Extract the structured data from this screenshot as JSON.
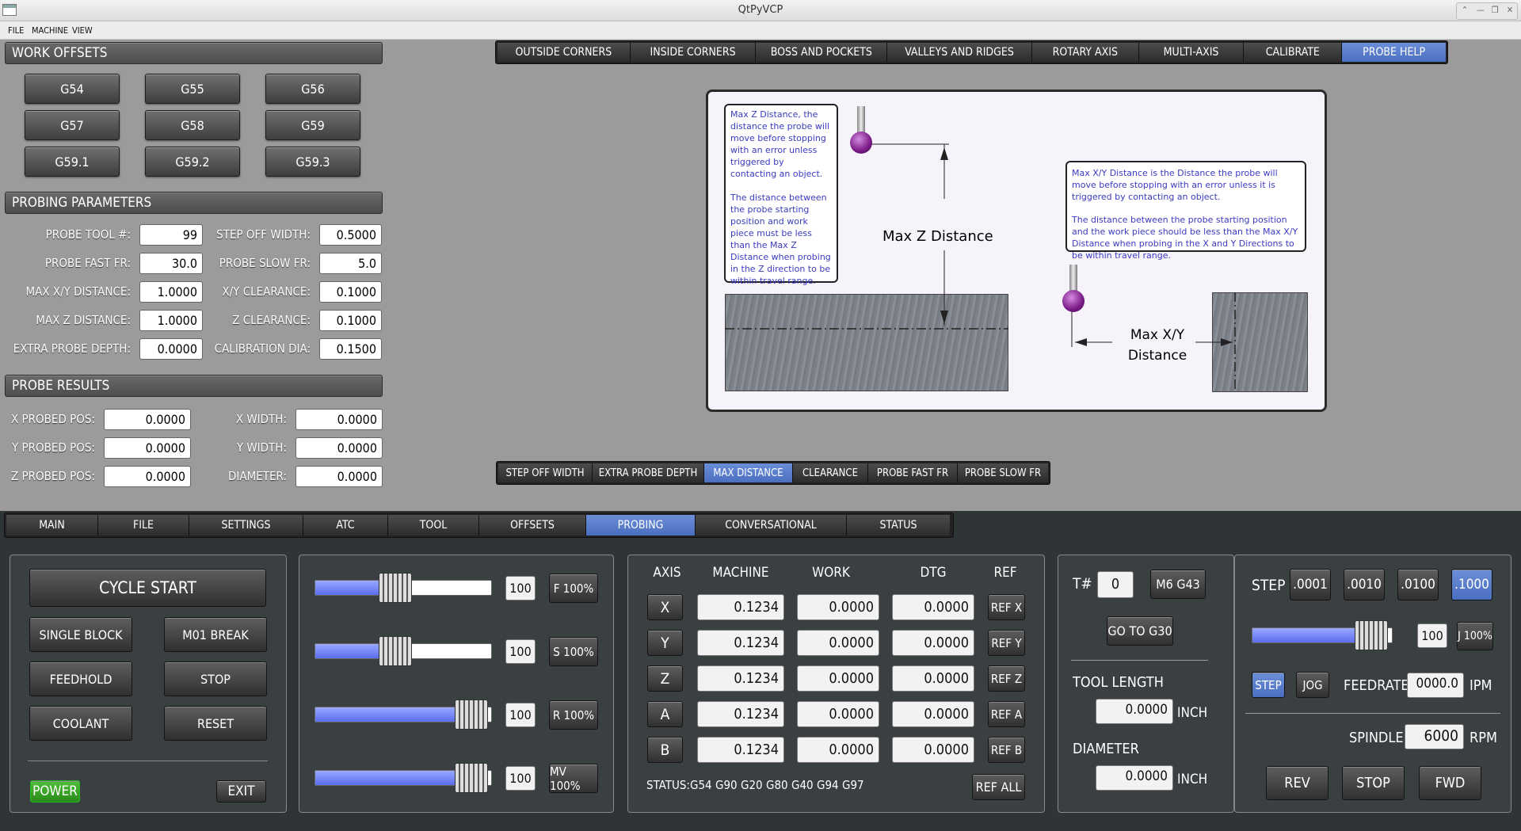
{
  "window": {
    "title": "QtPyVCP"
  },
  "menu": [
    "FILE",
    "MACHINE",
    "VIEW"
  ],
  "work_offsets": {
    "header": "WORK OFFSETS",
    "buttons": [
      "G54",
      "G55",
      "G56",
      "G57",
      "G58",
      "G59",
      "G59.1",
      "G59.2",
      "G59.3"
    ]
  },
  "probing_params": {
    "header": "PROBING PARAMETERS",
    "fields": [
      {
        "label": "PROBE TOOL #:",
        "value": "99"
      },
      {
        "label": "STEP OFF WIDTH:",
        "value": "0.5000"
      },
      {
        "label": "PROBE FAST FR:",
        "value": "30.0"
      },
      {
        "label": "PROBE SLOW FR:",
        "value": "5.0"
      },
      {
        "label": "MAX X/Y DISTANCE:",
        "value": "1.0000"
      },
      {
        "label": "X/Y CLEARANCE:",
        "value": "0.1000"
      },
      {
        "label": "MAX Z DISTANCE:",
        "value": "1.0000"
      },
      {
        "label": "Z CLEARANCE:",
        "value": "0.1000"
      },
      {
        "label": "EXTRA PROBE DEPTH:",
        "value": "0.0000"
      },
      {
        "label": "CALIBRATION DIA:",
        "value": "0.1500"
      }
    ]
  },
  "probe_results": {
    "header": "PROBE RESULTS",
    "fields": [
      {
        "label": "X PROBED POS:",
        "value": "0.0000"
      },
      {
        "label": "X WIDTH:",
        "value": "0.0000"
      },
      {
        "label": "Y PROBED POS:",
        "value": "0.0000"
      },
      {
        "label": "Y WIDTH:",
        "value": "0.0000"
      },
      {
        "label": "Z PROBED POS:",
        "value": "0.0000"
      },
      {
        "label": "DIAMETER:",
        "value": "0.0000"
      }
    ]
  },
  "probe_tabs": [
    "OUTSIDE CORNERS",
    "INSIDE CORNERS",
    "BOSS AND POCKETS",
    "VALLEYS AND RIDGES",
    "ROTARY AXIS",
    "MULTI-AXIS",
    "CALIBRATE",
    "PROBE HELP"
  ],
  "probe_tabs_active": 7,
  "help": {
    "note_z_1": "Max Z Distance, the distance the probe will move before stopping with an error unless triggered by contacting an object.",
    "note_z_2": "The distance between the probe starting position and work piece must be less than the Max Z Distance when probing in the Z direction to be within travel range.",
    "note_xy_1": "Max X/Y Distance is the Distance the probe will move before stopping with an error unless it is triggered by contacting an object.",
    "note_xy_2": "The distance between the probe starting position and the work piece should be less than the Max X/Y Distance when probing in the X and Y Directions to be within travel range.",
    "label_z": "Max Z Distance",
    "label_xy_line1": "Max X/Y",
    "label_xy_line2": "Distance"
  },
  "help_tabs": [
    "STEP OFF WIDTH",
    "EXTRA PROBE DEPTH",
    "MAX DISTANCE",
    "CLEARANCE",
    "PROBE FAST FR",
    "PROBE SLOW FR"
  ],
  "help_tabs_active": 2,
  "main_tabs": [
    "MAIN",
    "FILE",
    "SETTINGS",
    "ATC",
    "TOOL",
    "OFFSETS",
    "PROBING",
    "CONVERSATIONAL",
    "STATUS"
  ],
  "main_tabs_active": 6,
  "controls": {
    "cycle_start": "CYCLE START",
    "single_block": "SINGLE BLOCK",
    "m01_break": "M01 BREAK",
    "feedhold": "FEEDHOLD",
    "stop": "STOP",
    "coolant": "COOLANT",
    "reset": "RESET",
    "power": "POWER",
    "exit": "EXIT"
  },
  "overrides": [
    {
      "value": "100",
      "label": "F 100%",
      "fill": 0.45
    },
    {
      "value": "100",
      "label": "S 100%",
      "fill": 0.45
    },
    {
      "value": "100",
      "label": "R 100%",
      "fill": 0.88
    },
    {
      "value": "100",
      "label": "MV 100%",
      "fill": 0.88
    }
  ],
  "dro": {
    "headers": [
      "AXIS",
      "MACHINE",
      "WORK",
      "DTG",
      "REF"
    ],
    "rows": [
      {
        "axis": "X",
        "machine": "0.1234",
        "work": "0.0000",
        "dtg": "0.0000",
        "ref": "REF X"
      },
      {
        "axis": "Y",
        "machine": "0.1234",
        "work": "0.0000",
        "dtg": "0.0000",
        "ref": "REF Y"
      },
      {
        "axis": "Z",
        "machine": "0.1234",
        "work": "0.0000",
        "dtg": "0.0000",
        "ref": "REF Z"
      },
      {
        "axis": "A",
        "machine": "0.1234",
        "work": "0.0000",
        "dtg": "0.0000",
        "ref": "REF A"
      },
      {
        "axis": "B",
        "machine": "0.1234",
        "work": "0.0000",
        "dtg": "0.0000",
        "ref": "REF B"
      }
    ],
    "status_label": "STATUS:",
    "status_codes": [
      "G54",
      "G90",
      "G20",
      "G80",
      "G40",
      "G94",
      "G97"
    ],
    "ref_all": "REF ALL"
  },
  "tool": {
    "t_label": "T#",
    "t_value": "0",
    "m6_label": "M6 G43",
    "g30_label": "GO TO G30",
    "length_label": "TOOL LENGTH",
    "length_value": "0.0000",
    "length_unit": "INCH",
    "diameter_label": "DIAMETER",
    "diameter_value": "0.0000",
    "diameter_unit": "INCH"
  },
  "jog": {
    "step_label": "STEP",
    "steps": [
      ".0001",
      ".0010",
      ".0100",
      ".1000"
    ],
    "step_active": 3,
    "slider_value": "100",
    "slider_fill": 0.75,
    "jog_pct": "J 100%",
    "mode_step": "STEP",
    "mode_jog": "JOG",
    "feed_label": "FEEDRATE",
    "feed_value": "0000.0",
    "feed_unit": "IPM",
    "spindle_label": "SPINDLE",
    "spindle_value": "6000",
    "spindle_unit": "RPM",
    "rev": "REV",
    "stop": "STOP",
    "fwd": "FWD"
  }
}
